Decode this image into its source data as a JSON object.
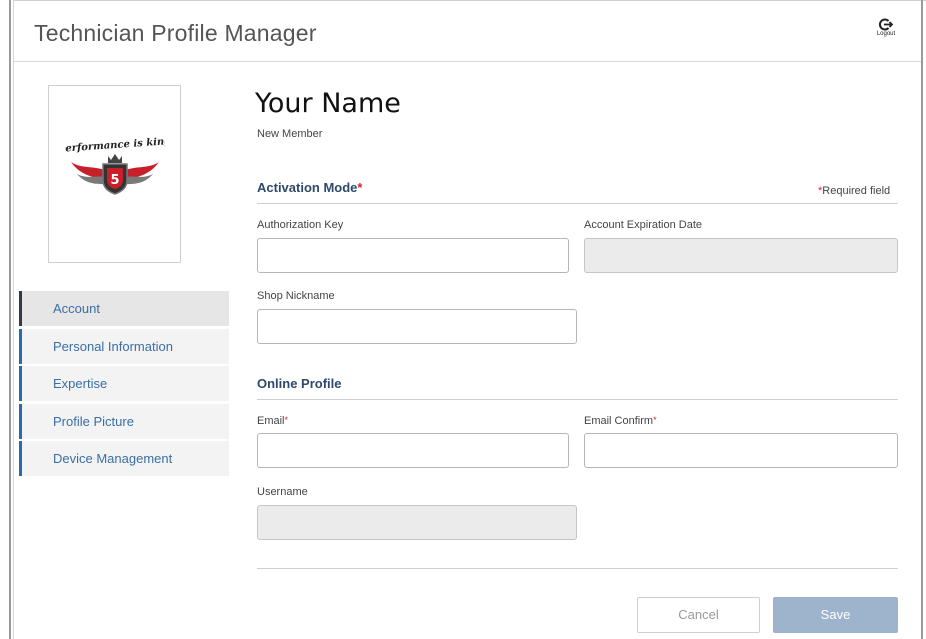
{
  "header": {
    "app_title": "Technician Profile Manager",
    "logout_label": "Logout",
    "logout_icon": "logout-icon"
  },
  "profile": {
    "name": "Your Name",
    "status": "New Member",
    "logo_text": "performance is king",
    "logo_badge": "5"
  },
  "sidebar": {
    "items": [
      {
        "label": "Account",
        "active": true
      },
      {
        "label": "Personal Information"
      },
      {
        "label": "Expertise"
      },
      {
        "label": "Profile Picture"
      },
      {
        "label": "Device Management"
      }
    ]
  },
  "activation": {
    "title": "Activation Mode",
    "required_star": "*",
    "required_note": "Required field",
    "auth_key_label": "Authorization Key",
    "auth_key_value": "",
    "expiration_label": "Account Expiration Date",
    "expiration_value": "",
    "shop_nickname_label": "Shop Nickname",
    "shop_nickname_value": ""
  },
  "online_profile": {
    "title": "Online Profile",
    "email_label": "Email",
    "email_value": "",
    "email_confirm_label": "Email Confirm",
    "email_confirm_value": "",
    "username_label": "Username",
    "username_value": ""
  },
  "actions": {
    "cancel_label": "Cancel",
    "save_label": "Save"
  },
  "colors": {
    "accent": "#2a6aa8",
    "required": "#d0262b",
    "save_disabled": "#9db4cc"
  }
}
